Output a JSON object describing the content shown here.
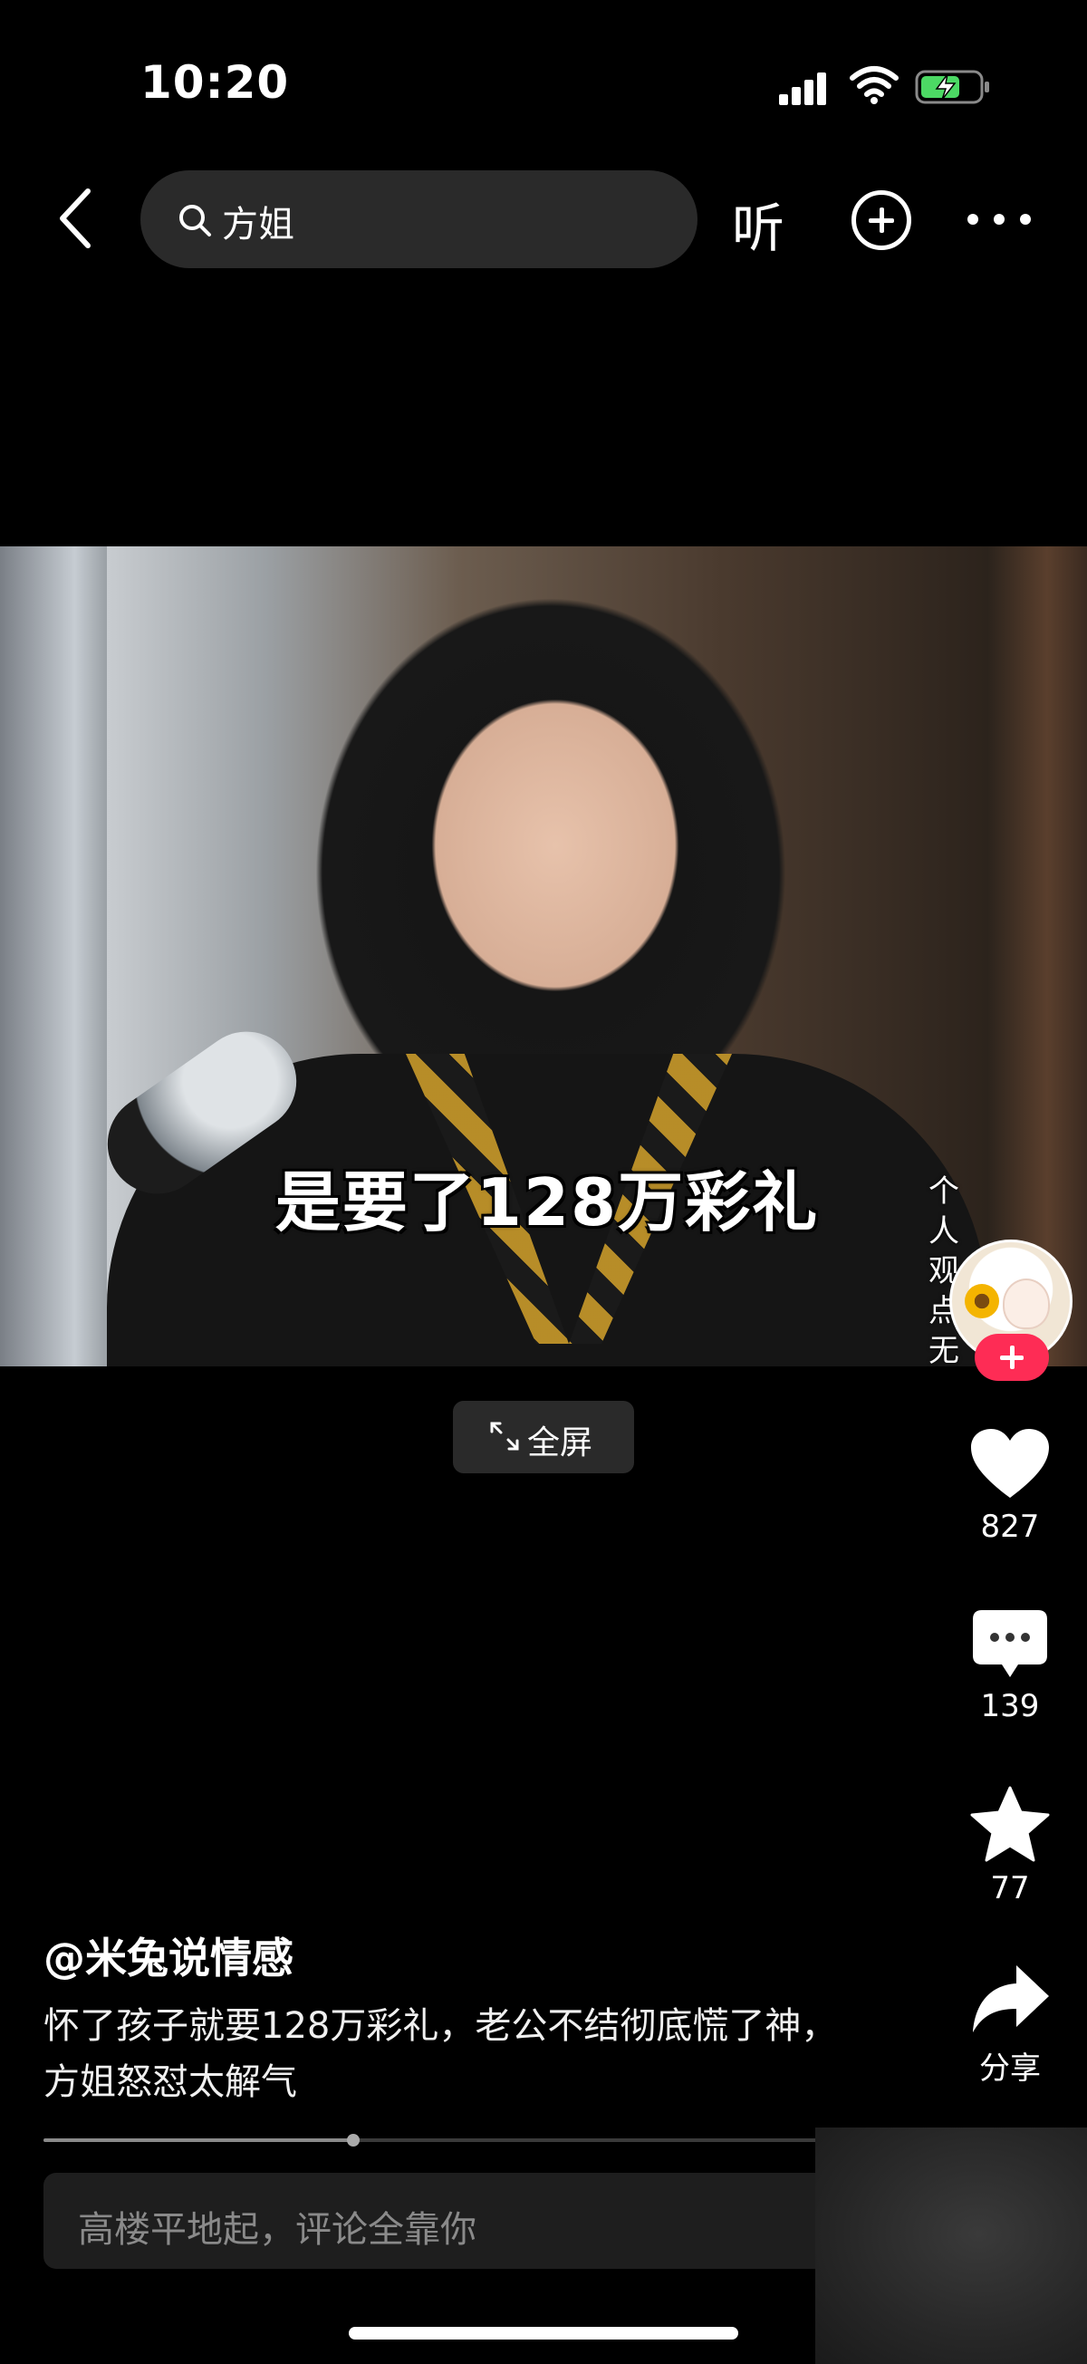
{
  "status_bar": {
    "time": "10:20"
  },
  "search": {
    "query": "方姐"
  },
  "nav": {
    "listen_label": "听"
  },
  "video": {
    "subtitle": "是要了128万彩礼",
    "side_note": "个人观点无不",
    "fullscreen_label": "全屏"
  },
  "actions": {
    "likes": "827",
    "comments": "139",
    "favorites": "77",
    "share_label": "分享"
  },
  "post": {
    "author": "@米兔说情感",
    "description_line1": "怀了孩子就要128万彩礼，老公不结彻底慌了神，",
    "description_line2": "方姐怒怼太解气"
  },
  "progress": {
    "fraction": 0.31
  },
  "comment": {
    "placeholder": "高楼平地起，评论全靠你"
  },
  "colors": {
    "accent": "#fe2c55",
    "battery": "#4cd964"
  },
  "icons": [
    "back-icon",
    "search-icon",
    "add-icon",
    "more-icon",
    "heart-icon",
    "comment-icon",
    "star-icon",
    "share-icon",
    "fullscreen-icon"
  ]
}
